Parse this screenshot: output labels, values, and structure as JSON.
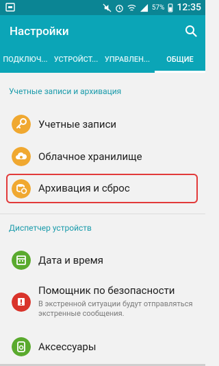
{
  "status_bar": {
    "battery_percent": "57%",
    "time": "12:35",
    "icons": [
      "notification-icon",
      "mute-icon",
      "alarm-icon",
      "wifi-icon",
      "signal-icon",
      "battery-icon"
    ]
  },
  "app_bar": {
    "title": "Настройки",
    "search_icon": "search-icon"
  },
  "tabs": [
    {
      "label": "ПОДКЛЮЧ..."
    },
    {
      "label": "УСТРОЙСТ..."
    },
    {
      "label": "УПРАВЛЕН..."
    },
    {
      "label": "ОБЩИЕ",
      "active": true
    }
  ],
  "sections": [
    {
      "header": "Учетные записи и архивация",
      "items": [
        {
          "label": "Учетные записи",
          "icon": "key-icon",
          "color": "#f0a830"
        },
        {
          "label": "Облачное хранилище",
          "icon": "cloud-icon",
          "color": "#f0a830"
        },
        {
          "label": "Архивация и сброс",
          "icon": "backup-icon",
          "color": "#f0a830",
          "highlighted": true
        }
      ]
    },
    {
      "header": "Диспетчер устройств",
      "items": [
        {
          "label": "Дата и время",
          "icon": "calendar-icon",
          "color": "#5aaa2e"
        },
        {
          "label": "Помощник по безопасности",
          "sublabel": "В экстренной ситуации будут отправляться экстренные сообщения.",
          "icon": "emergency-icon",
          "color": "#d9342b"
        },
        {
          "label": "Аксессуары",
          "icon": "accessory-icon",
          "color": "#5aaa2e"
        }
      ]
    }
  ],
  "colors": {
    "status_bar": "#0b8594",
    "app_bar": "#0ba5b7",
    "section_header": "#1a9bab",
    "highlight_border": "#e23a3a"
  }
}
